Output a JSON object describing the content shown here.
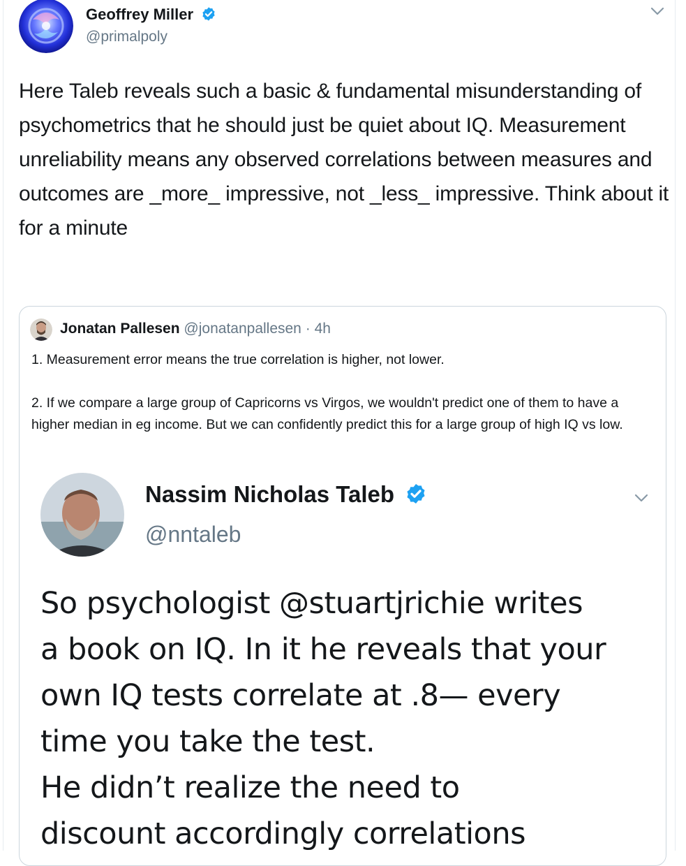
{
  "tweet": {
    "author": {
      "name": "Geoffrey Miller",
      "handle": "@primalpoly"
    },
    "text": "Here Taleb reveals such a basic & fundamental misunderstanding of psychometrics that he should just be quiet about IQ. Measurement unreliability means any observed correlations between measures and outcomes are _more_ impressive, not _less_ impressive. Think about it for a minute"
  },
  "quoted": {
    "author": {
      "name": "Jonatan Pallesen",
      "handle": "@jonatanpallesen",
      "separator": "·",
      "time": "4h"
    },
    "paragraphs": [
      "1. Measurement error means the true correlation is higher, not lower.",
      "2. If we compare a large group of Capricorns vs Virgos, we wouldn't predict one of them to have a higher median in eg income. But we can confidently predict this for a large group of high IQ vs low."
    ],
    "embedded": {
      "author": {
        "name": "Nassim Nicholas Taleb",
        "handle": "@nntaleb"
      },
      "lines": [
        "So psychologist @stuartjrichie writes",
        "a book on IQ. In it he reveals that your",
        "own IQ tests correlate at .8— every",
        "time you take the test.",
        "He didn’t realize the need to",
        "discount accordingly correlations"
      ]
    }
  },
  "colors": {
    "verified": "#1da1f2",
    "secondary_text": "#657786",
    "border": "#ccd6dd"
  }
}
